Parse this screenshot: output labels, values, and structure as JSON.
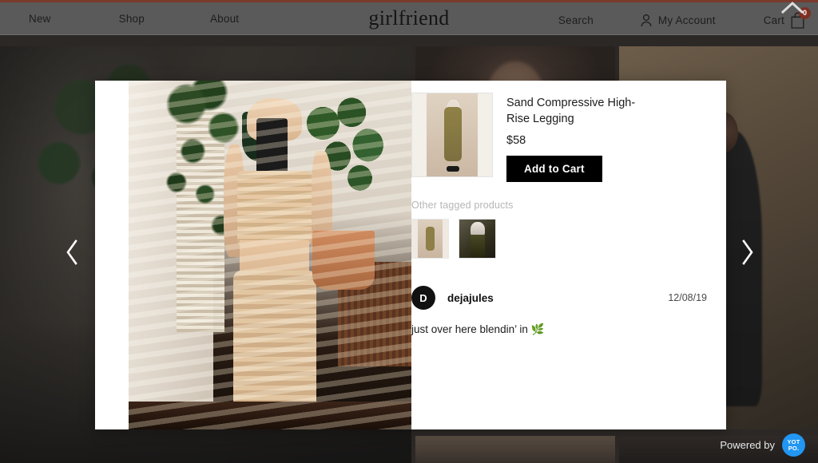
{
  "header": {
    "brand": "girlfriend",
    "nav_left": [
      {
        "label": "New",
        "name": "nav-new"
      },
      {
        "label": "Shop",
        "name": "nav-shop"
      },
      {
        "label": "About",
        "name": "nav-about"
      }
    ],
    "search_label": "Search",
    "account_label": "My Account",
    "cart_label": "Cart",
    "cart_count": "0",
    "accent_color": "#7a3a2c",
    "bar_color": "#5a5a5a"
  },
  "carousel": {
    "prev_label": "‹",
    "next_label": "›",
    "collapse_label": "⌃"
  },
  "modal": {
    "product": {
      "title": "Sand Compressive High-Rise Legging",
      "price": "$58",
      "add_to_cart_label": "Add to Cart"
    },
    "tagged": {
      "label": "Other tagged products",
      "count": 2
    },
    "comment": {
      "avatar_initial": "D",
      "username": "dejajules",
      "date": "12/08/19",
      "text": "just over here blendin’ in 🌿"
    }
  },
  "footer": {
    "powered_by_label": "Powered by",
    "brand_line1": "YOT",
    "brand_line2": "PO.",
    "brand_color": "#2196f3"
  }
}
